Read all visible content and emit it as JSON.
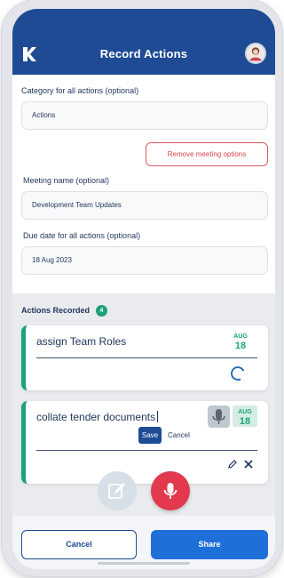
{
  "header": {
    "title": "Record Actions",
    "logo_icon": "k-logo-icon",
    "avatar_icon": "user-avatar-icon"
  },
  "form": {
    "category_label": "Category for all actions (optional)",
    "category_value": "Actions",
    "remove_meeting_label": "Remove meeting options",
    "meeting_name_label": "Meeting name (optional)",
    "meeting_name_value": "Development Team Updates",
    "due_date_label": "Due date for all actions (optional)",
    "due_date_value": "18 Aug 2023"
  },
  "actions": {
    "title": "Actions Recorded",
    "count": "4",
    "items": [
      {
        "text": "assign Team Roles",
        "month": "AUG",
        "day": "18",
        "status_icon": "loading-spinner-icon"
      },
      {
        "text": "collate tender documents",
        "month": "AUG",
        "day": "18",
        "save_label": "Save",
        "cancel_label": "Cancel",
        "edit_icon": "pencil-icon",
        "delete_icon": "close-icon"
      }
    ]
  },
  "fab": {
    "edit_icon": "edit-note-icon",
    "mic_icon": "microphone-icon"
  },
  "footer": {
    "cancel_label": "Cancel",
    "share_label": "Share"
  },
  "colors": {
    "primary": "#1e4b94",
    "accent_green": "#1aa37b",
    "danger": "#e2394f",
    "share_blue": "#1f6fd8"
  }
}
